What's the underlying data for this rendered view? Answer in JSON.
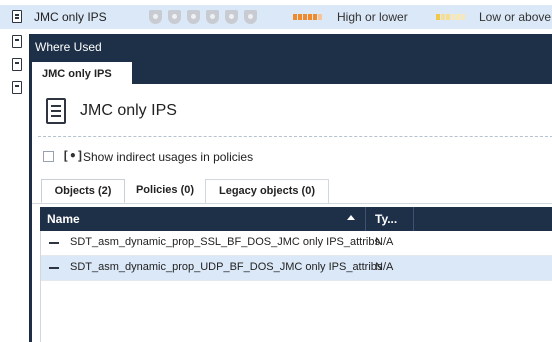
{
  "background": {
    "row": {
      "name": "JMC only IPS",
      "blade_icons": [
        "shield-icon",
        "badge-icon",
        "star-shield-icon",
        "gear-shield-icon",
        "check-shield-icon",
        "lock-shield-icon"
      ],
      "severity_label": "High or lower",
      "confidence_label": "Low or above",
      "severity_color": "#f08a2c",
      "confidence_color": "#f2c84b"
    }
  },
  "dialog": {
    "title": "Where Used",
    "tab_label": "JMC only IPS",
    "object_name": "JMC only IPS",
    "indirect_icon": "[•]",
    "checkbox_label": "Show indirect usages in policies",
    "sub_tabs": [
      {
        "label": "Objects (2)"
      },
      {
        "label": "Policies (0)"
      },
      {
        "label": "Legacy objects (0)"
      }
    ],
    "grid": {
      "columns": [
        "Name",
        "Ty..."
      ],
      "rows": [
        {
          "name": "SDT_asm_dynamic_prop_SSL_BF_DOS_JMC only IPS_attribs",
          "type": "N/A"
        },
        {
          "name": "SDT_asm_dynamic_prop_UDP_BF_DOS_JMC only IPS_attribs",
          "type": "N/A"
        }
      ]
    }
  },
  "colors": {
    "dialog_header": "#1e3048",
    "selection": "#dbe8f7"
  }
}
